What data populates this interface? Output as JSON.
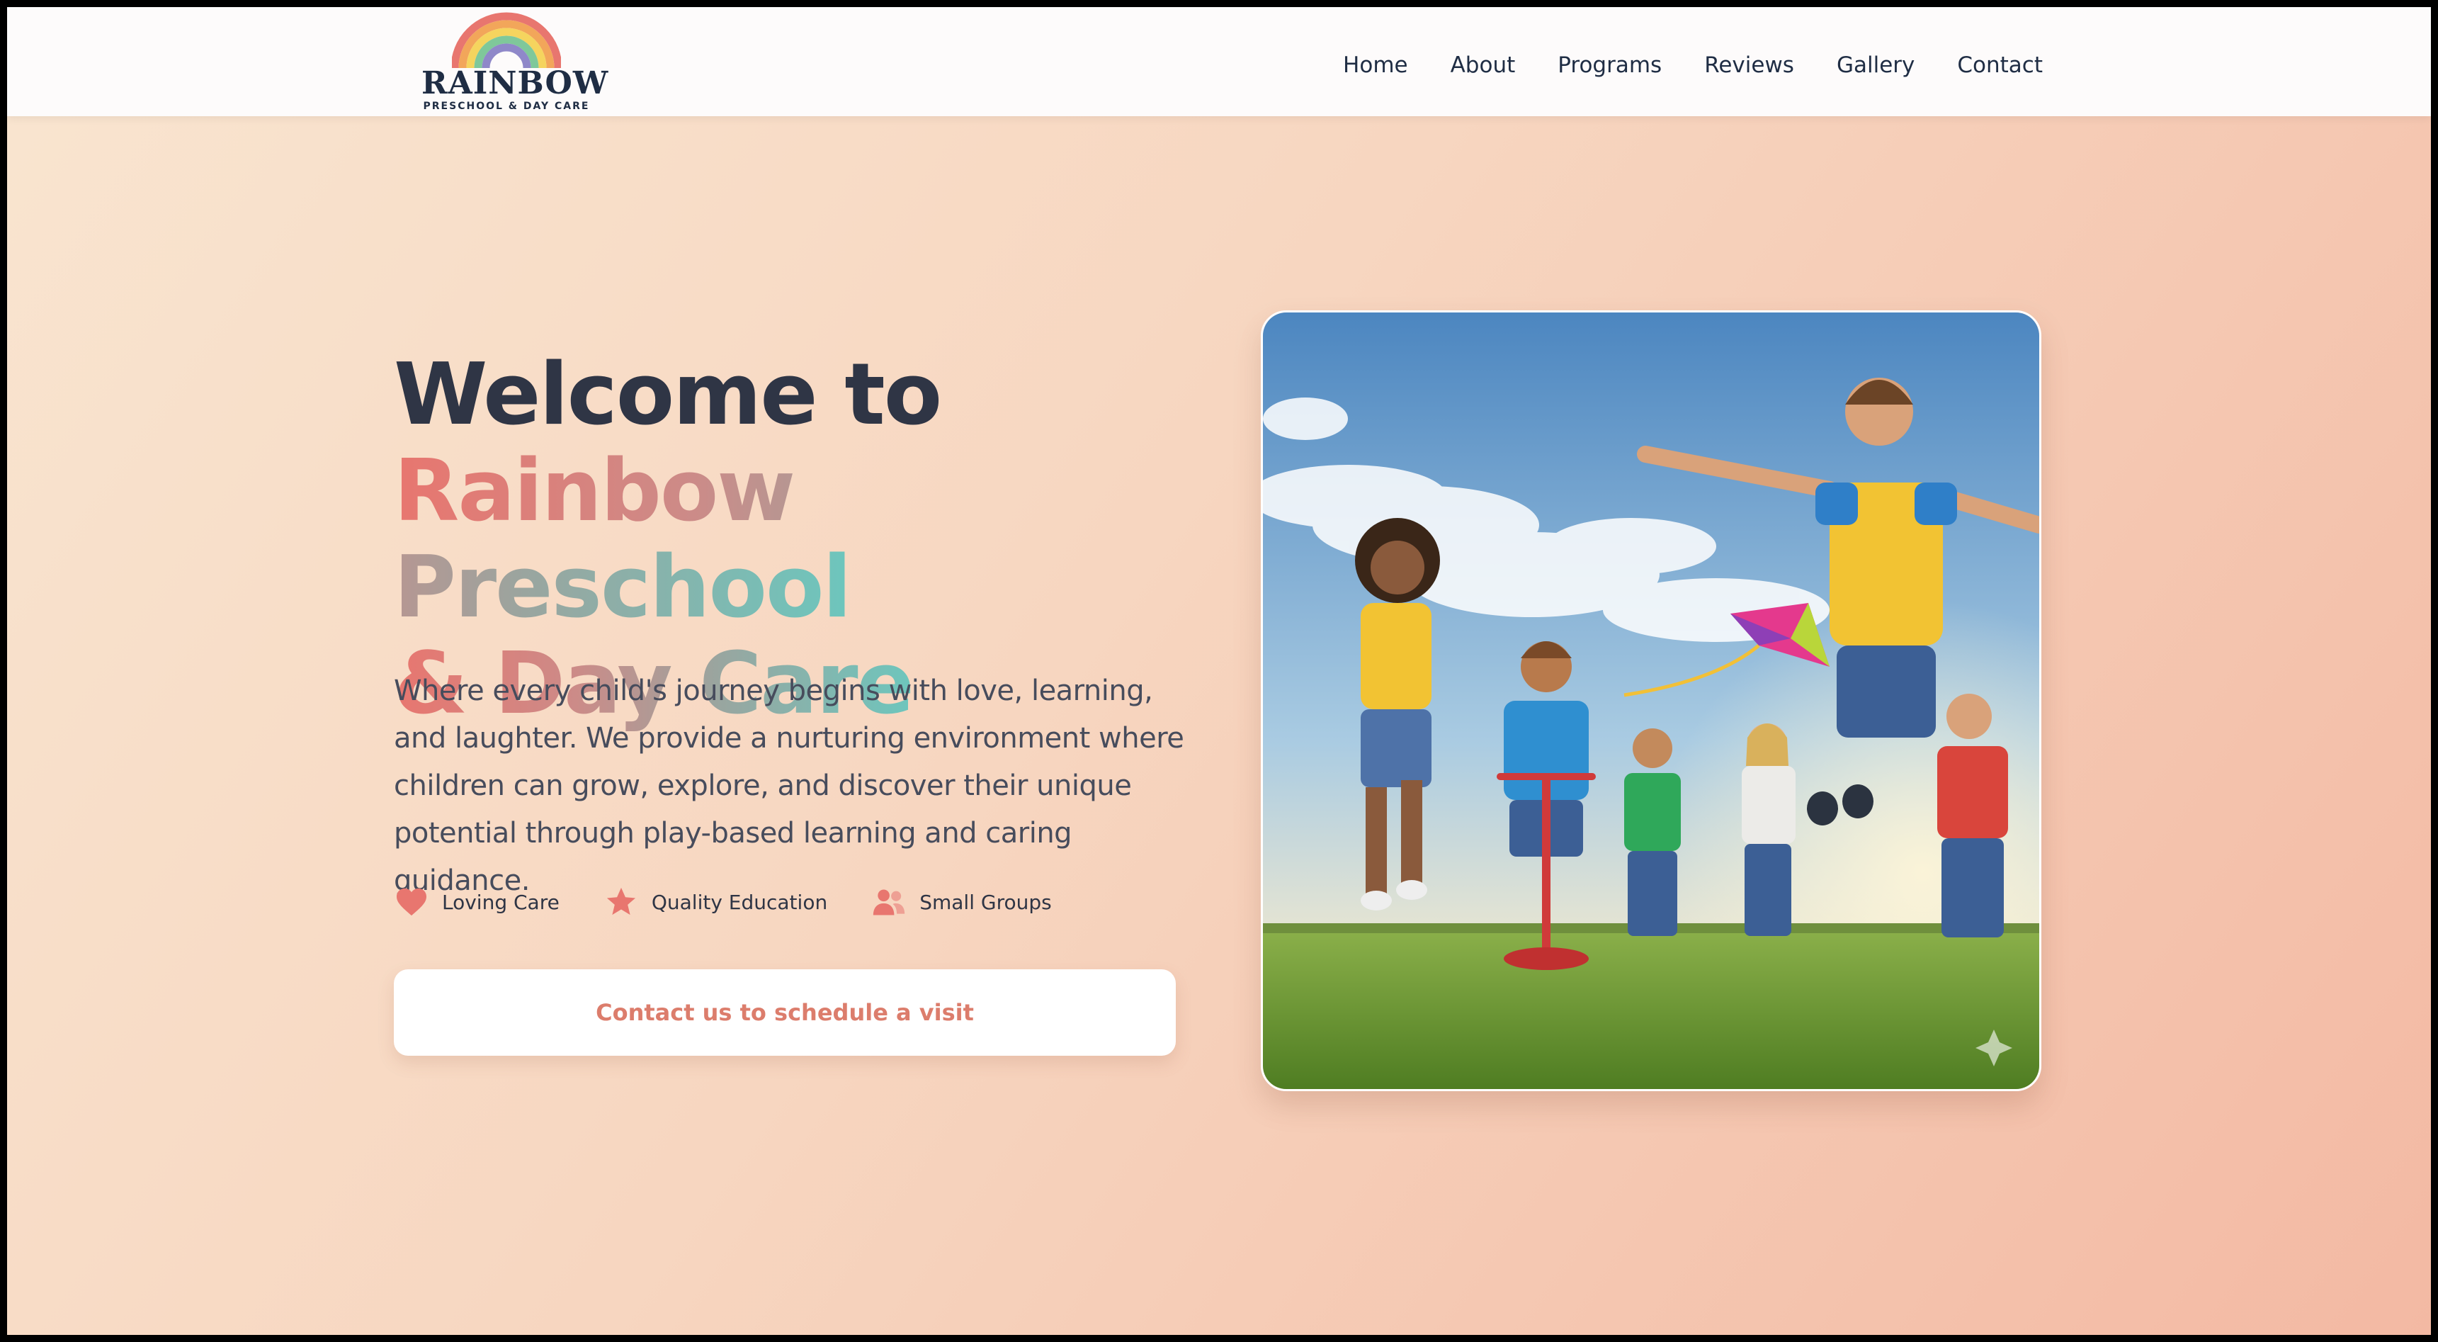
{
  "logo": {
    "title": "RAINBOW",
    "subtitle": "PRESCHOOL & DAY CARE"
  },
  "nav": {
    "items": [
      "Home",
      "About",
      "Programs",
      "Reviews",
      "Gallery",
      "Contact"
    ]
  },
  "hero": {
    "title_line1": "Welcome to",
    "title_highlight_1": "Rainbow Preschool",
    "title_highlight_2": "& Day Care",
    "description": "Where every child's journey begins with love, learning, and laughter. We provide a nurturing environment where children can grow, explore, and discover their unique potential through play-based learning and caring guidance.",
    "features": [
      {
        "icon": "heart-icon",
        "label": "Loving Care"
      },
      {
        "icon": "star-icon",
        "label": "Quality Education"
      },
      {
        "icon": "users-icon",
        "label": "Small Groups"
      }
    ],
    "cta_label": "Contact us to schedule a visit",
    "image_description": "Children running and jumping on a grassy field with a kite under a blue sky"
  },
  "colors": {
    "accent": "#e8766f",
    "teal": "#6dc6bd",
    "text_dark": "#2f3545",
    "cta_text": "#dc7d6c"
  }
}
